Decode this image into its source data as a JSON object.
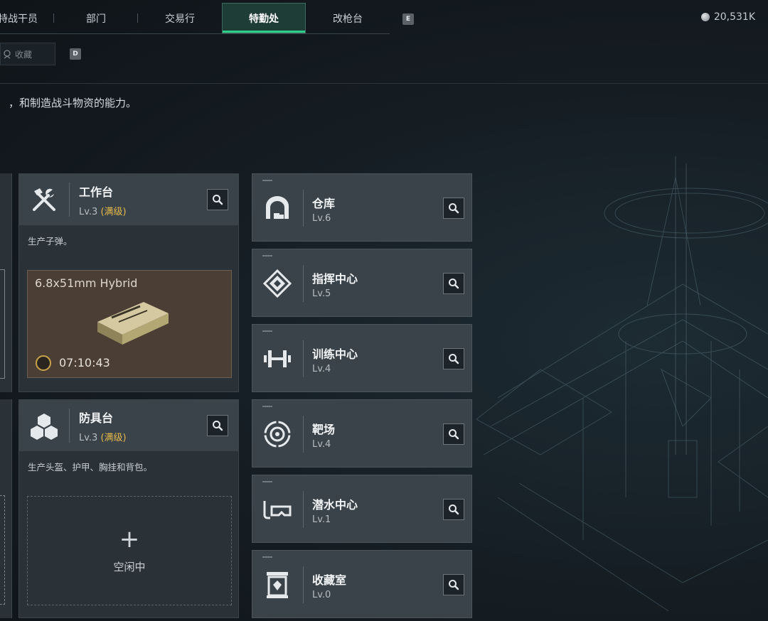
{
  "nav": {
    "tabs": [
      {
        "label": "特战干员"
      },
      {
        "label": "部门"
      },
      {
        "label": "交易行"
      },
      {
        "label": "特勤处",
        "active": true
      },
      {
        "label": "改枪台"
      }
    ],
    "next_key": "E",
    "prev_key": "D"
  },
  "currency": {
    "value": "20,531K"
  },
  "subbar": {
    "favorites_label": "收藏"
  },
  "description": "，和制造战斗物资的能力。",
  "workbench": {
    "name": "工作台",
    "level": "Lv.3",
    "level_tag": "(满级)",
    "desc": "生产子弹。",
    "production": {
      "item": "6.8x51mm Hybrid",
      "timer": "07:10:43"
    }
  },
  "armor_bench": {
    "name": "防具台",
    "level": "Lv.3",
    "level_tag": "(满级)",
    "desc": "生产头盔、护甲、胸挂和背包。",
    "idle_label": "空闲中",
    "idle_plus": "+"
  },
  "facilities": [
    {
      "name": "仓库",
      "level": "Lv.6",
      "icon": "warehouse-icon"
    },
    {
      "name": "指挥中心",
      "level": "Lv.5",
      "icon": "command-center-icon"
    },
    {
      "name": "训练中心",
      "level": "Lv.4",
      "icon": "dumbbell-icon"
    },
    {
      "name": "靶场",
      "level": "Lv.4",
      "icon": "target-icon"
    },
    {
      "name": "潜水中心",
      "level": "Lv.1",
      "icon": "diving-mask-icon"
    },
    {
      "name": "收藏室",
      "level": "Lv.0",
      "icon": "collection-room-icon"
    }
  ],
  "colors": {
    "accent": "#2fd08c",
    "max_level": "#e4b94a",
    "card_bg": "#3a4349"
  }
}
